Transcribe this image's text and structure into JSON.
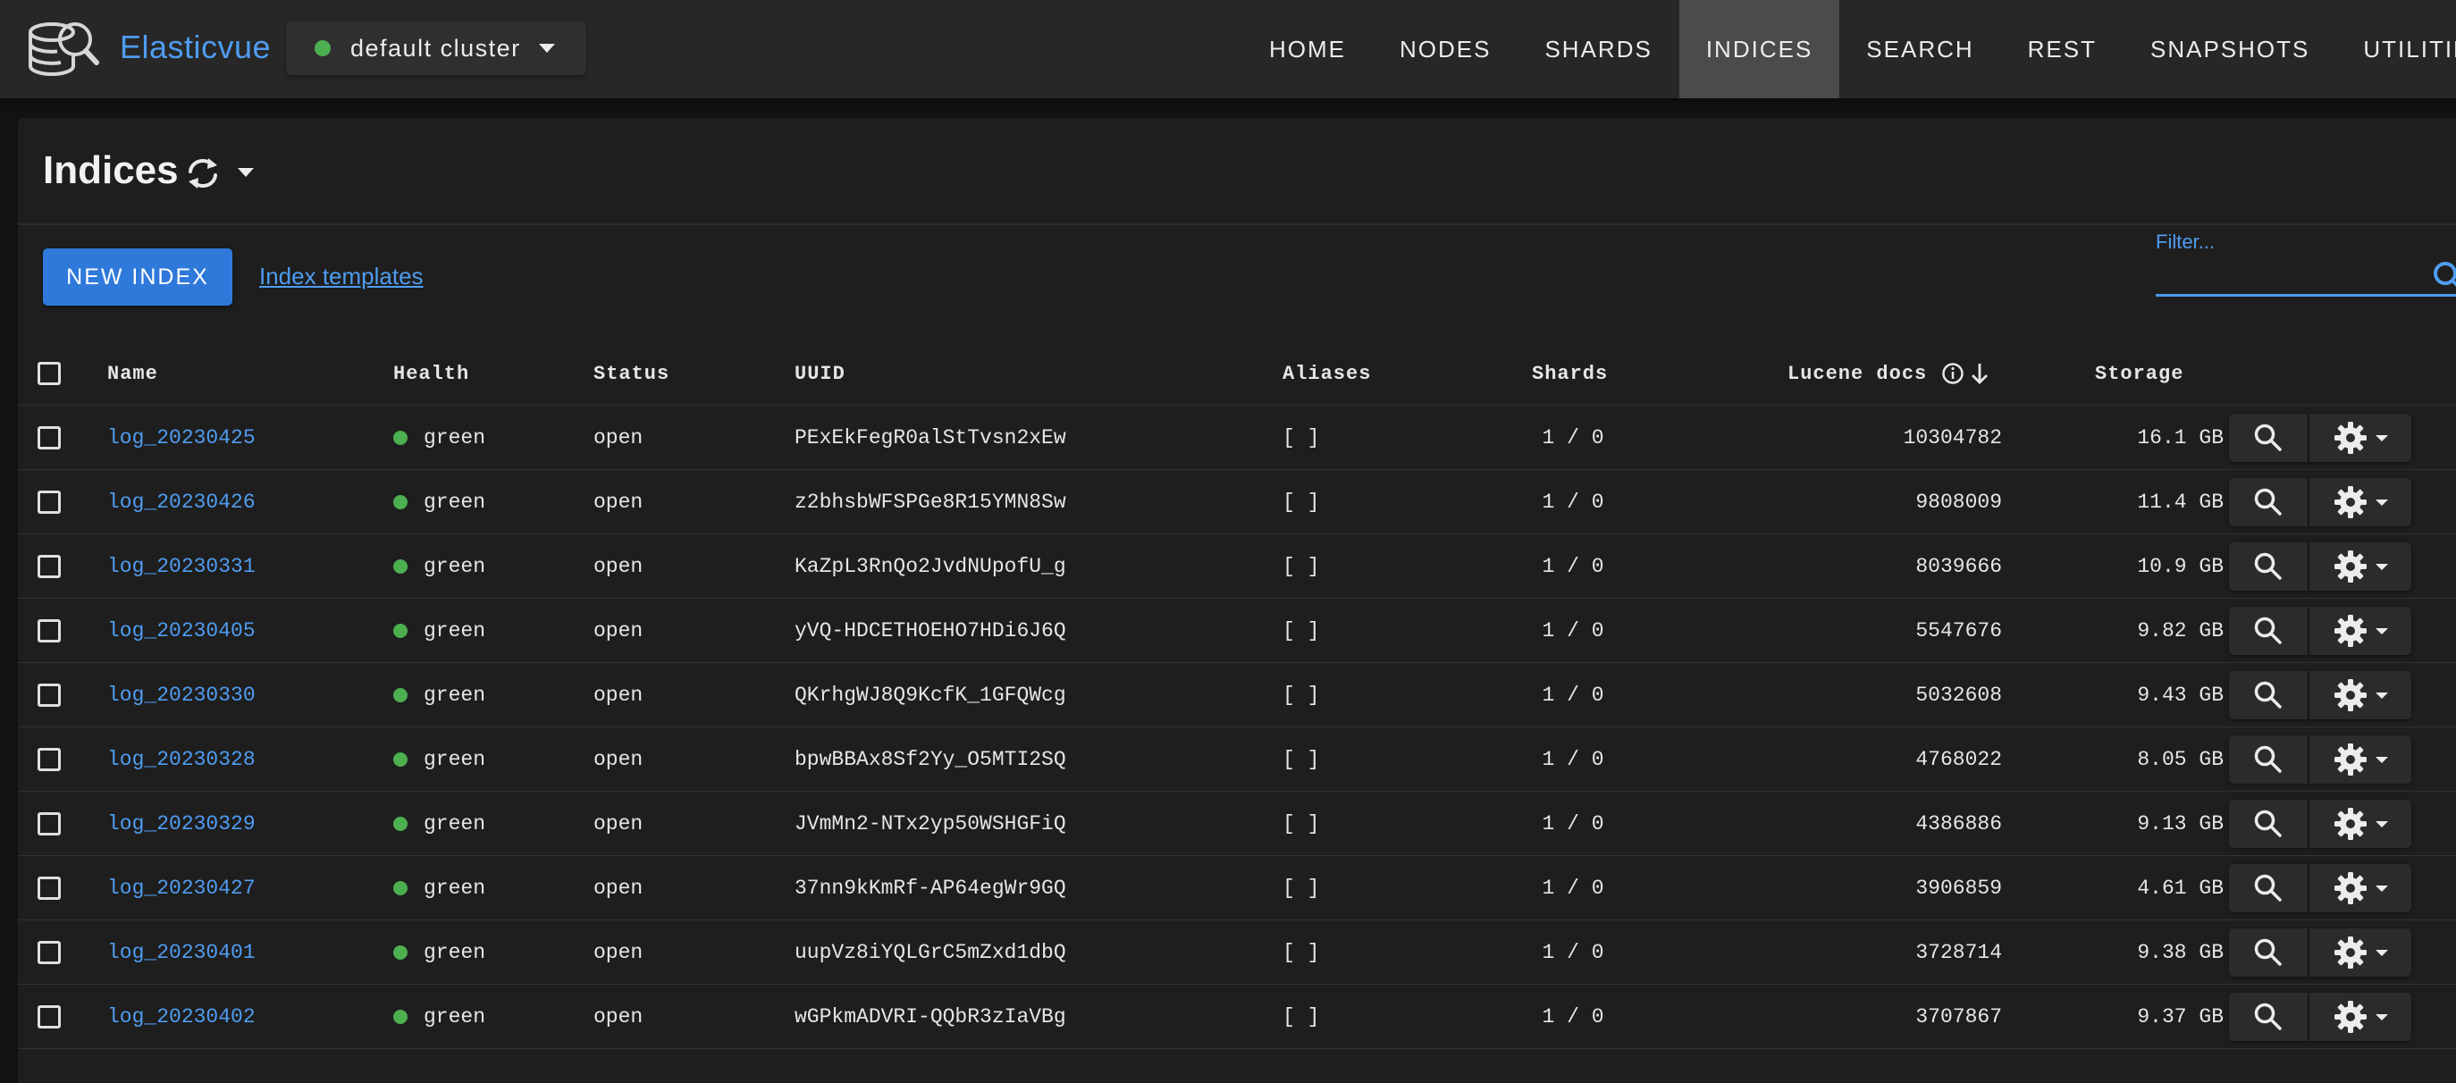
{
  "app": {
    "brand": "Elasticvue",
    "cluster": {
      "name": "default cluster",
      "status_color": "#4caf50"
    }
  },
  "nav": {
    "items": [
      {
        "label": "HOME",
        "active": false
      },
      {
        "label": "NODES",
        "active": false
      },
      {
        "label": "SHARDS",
        "active": false
      },
      {
        "label": "INDICES",
        "active": true
      },
      {
        "label": "SEARCH",
        "active": false
      },
      {
        "label": "REST",
        "active": false
      },
      {
        "label": "SNAPSHOTS",
        "active": false
      },
      {
        "label": "UTILITIES",
        "active": false
      }
    ]
  },
  "page": {
    "title": "Indices",
    "new_index_label": "NEW INDEX",
    "templates_link": "Index templates",
    "filter": {
      "label": "Filter...",
      "value": ""
    }
  },
  "table": {
    "headers": {
      "name": "Name",
      "health": "Health",
      "status": "Status",
      "uuid": "UUID",
      "aliases": "Aliases",
      "shards": "Shards",
      "lucene_docs": "Lucene docs",
      "storage": "Storage"
    },
    "rows": [
      {
        "name": "log_20230425",
        "health": "green",
        "status": "open",
        "uuid": "PExEkFegR0alStTvsn2xEw",
        "aliases": "[ ]",
        "shards": "1 / 0",
        "docs": "10304782",
        "storage": "16.1 GB"
      },
      {
        "name": "log_20230426",
        "health": "green",
        "status": "open",
        "uuid": "z2bhsbWFSPGe8R15YMN8Sw",
        "aliases": "[ ]",
        "shards": "1 / 0",
        "docs": "9808009",
        "storage": "11.4 GB"
      },
      {
        "name": "log_20230331",
        "health": "green",
        "status": "open",
        "uuid": "KaZpL3RnQo2JvdNUpofU_g",
        "aliases": "[ ]",
        "shards": "1 / 0",
        "docs": "8039666",
        "storage": "10.9 GB"
      },
      {
        "name": "log_20230405",
        "health": "green",
        "status": "open",
        "uuid": "yVQ-HDCETHOEHO7HDi6J6Q",
        "aliases": "[ ]",
        "shards": "1 / 0",
        "docs": "5547676",
        "storage": "9.82 GB"
      },
      {
        "name": "log_20230330",
        "health": "green",
        "status": "open",
        "uuid": "QKrhgWJ8Q9KcfK_1GFQWcg",
        "aliases": "[ ]",
        "shards": "1 / 0",
        "docs": "5032608",
        "storage": "9.43 GB"
      },
      {
        "name": "log_20230328",
        "health": "green",
        "status": "open",
        "uuid": "bpwBBAx8Sf2Yy_O5MTI2SQ",
        "aliases": "[ ]",
        "shards": "1 / 0",
        "docs": "4768022",
        "storage": "8.05 GB"
      },
      {
        "name": "log_20230329",
        "health": "green",
        "status": "open",
        "uuid": "JVmMn2-NTx2yp50WSHGFiQ",
        "aliases": "[ ]",
        "shards": "1 / 0",
        "docs": "4386886",
        "storage": "9.13 GB"
      },
      {
        "name": "log_20230427",
        "health": "green",
        "status": "open",
        "uuid": "37nn9kKmRf-AP64egWr9GQ",
        "aliases": "[ ]",
        "shards": "1 / 0",
        "docs": "3906859",
        "storage": "4.61 GB"
      },
      {
        "name": "log_20230401",
        "health": "green",
        "status": "open",
        "uuid": "uupVz8iYQLGrC5mZxd1dbQ",
        "aliases": "[ ]",
        "shards": "1 / 0",
        "docs": "3728714",
        "storage": "9.38 GB"
      },
      {
        "name": "log_20230402",
        "health": "green",
        "status": "open",
        "uuid": "wGPkmADVRI-QQbR3zIaVBg",
        "aliases": "[ ]",
        "shards": "1 / 0",
        "docs": "3707867",
        "storage": "9.37 GB"
      }
    ]
  },
  "icons": {
    "logo": "elasticvue-logo-icon",
    "refresh": "refresh-icon",
    "filter_search": "search-icon",
    "info": "info-icon",
    "sort": "arrow-down-icon",
    "row_search": "search-icon",
    "row_settings": "gear-icon"
  }
}
